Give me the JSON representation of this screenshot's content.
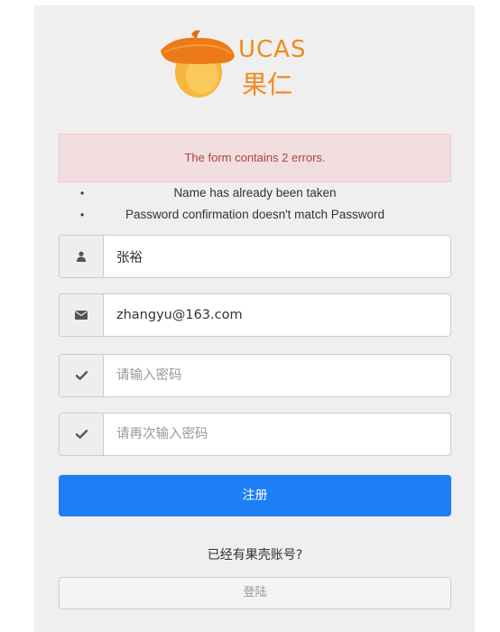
{
  "logo": {
    "text_en": "UCAS",
    "text_cn": "果仁"
  },
  "errors": {
    "summary": "The form contains 2 errors.",
    "items": [
      "Name has already been taken",
      "Password confirmation doesn't match Password"
    ]
  },
  "form": {
    "name": {
      "value": "张裕",
      "icon": "user-icon"
    },
    "email": {
      "value": "zhangyu@163.com",
      "icon": "envelope-icon"
    },
    "password": {
      "placeholder": "请输入密码",
      "icon": "check-icon"
    },
    "password_confirm": {
      "placeholder": "请再次输入密码",
      "icon": "check-icon"
    },
    "submit_label": "注册"
  },
  "login": {
    "prompt": "已经有果壳账号?",
    "button_label": "登陆"
  },
  "colors": {
    "brand_orange": "#f08a1c",
    "primary_blue": "#1e7ff5",
    "error_bg": "#f2dede",
    "error_text": "#a94442"
  }
}
